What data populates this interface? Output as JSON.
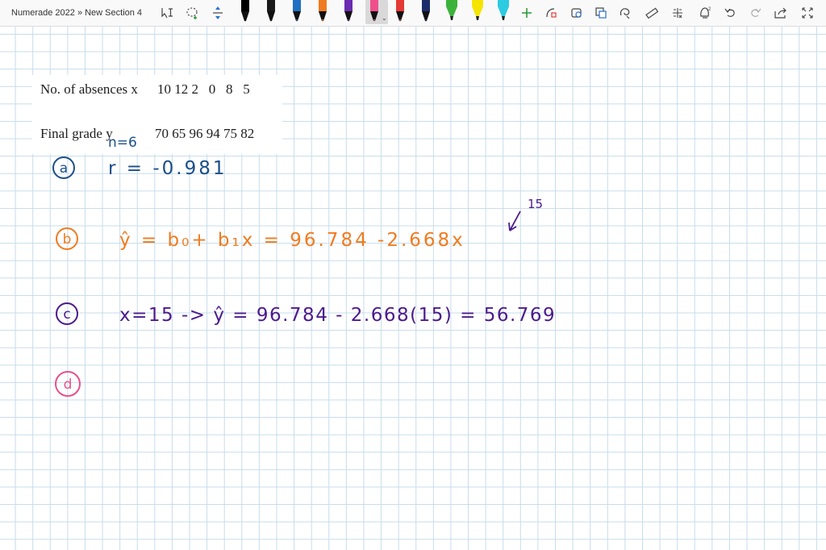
{
  "app": {
    "breadcrumb": "Numerade 2022 » New Section 4"
  },
  "toolbar": {
    "tools": [
      {
        "name": "lasso-select-icon"
      },
      {
        "name": "lasso-icon"
      },
      {
        "name": "add-space-icon"
      }
    ],
    "pens": [
      {
        "name": "pen-black",
        "color": "#000000"
      },
      {
        "name": "pen-black-2",
        "color": "#1a1a1a"
      },
      {
        "name": "pen-blue",
        "color": "#1f6fc2"
      },
      {
        "name": "pen-orange",
        "color": "#f07b1f"
      },
      {
        "name": "pen-purple",
        "color": "#6a2cb0"
      },
      {
        "name": "pen-pink",
        "color": "#f04f8c"
      },
      {
        "name": "pen-red",
        "color": "#e53935"
      },
      {
        "name": "pen-navy",
        "color": "#1b2c6b"
      },
      {
        "name": "highlighter-green",
        "color": "#3bb33b"
      },
      {
        "name": "highlighter-yellow",
        "color": "#f5e400"
      },
      {
        "name": "highlighter-cyan",
        "color": "#2ccbe0"
      }
    ],
    "right_icons": [
      "add-pen-icon",
      "ink-to-shape-icon",
      "ink-to-text-icon",
      "shapes-icon",
      "lasso-cut-icon",
      "ruler-icon",
      "math-icon",
      "replay-icon",
      "undo-icon",
      "redo-icon",
      "share-icon",
      "fullscreen-icon"
    ]
  },
  "problem": {
    "line1_label": "No. of absences x",
    "line1_values": "10 12 2   0   8   5",
    "line2_label": "Final grade y",
    "line2_values": "70 65 96 94 75 82"
  },
  "handwriting": {
    "n_note": "n=6",
    "part_a_marker": "a",
    "part_a_text": "r = -0.981",
    "part_b_marker": "b",
    "part_b_text": "ŷ = b₀+ b₁x = 96.784  -2.668x",
    "part_b_annotation": "15",
    "part_c_marker": "c",
    "part_c_text": "x=15 ->  ŷ = 96.784 - 2.668(15) = 56.769",
    "part_d_marker": "d"
  },
  "colors": {
    "blue_ink": "#1b4f8a",
    "orange_ink": "#f07b1f",
    "purple_ink": "#4b1a8c",
    "pink_ink": "#e8508a",
    "grid": "#c6dcea"
  }
}
